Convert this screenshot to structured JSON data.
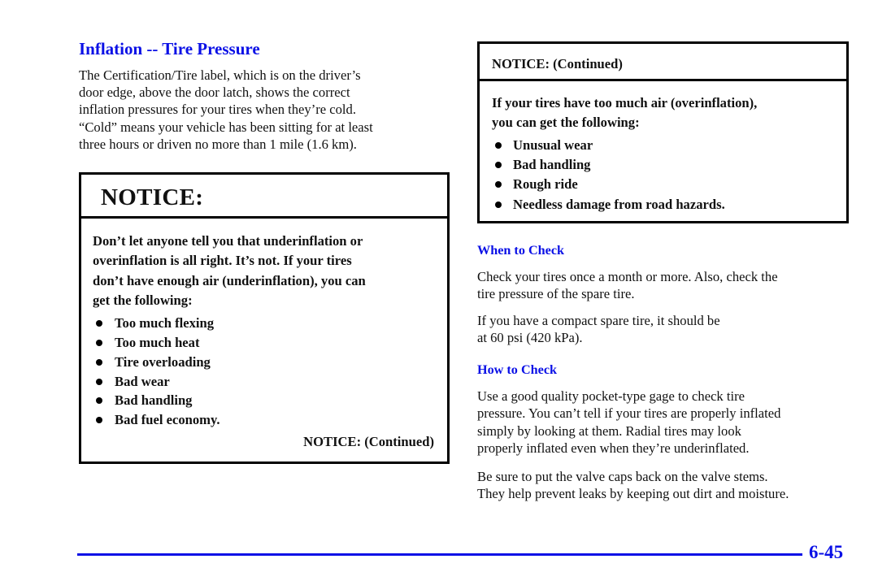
{
  "colors": {
    "accent": "#0a10e6",
    "text": "#111111",
    "border": "#000000"
  },
  "left_column": {
    "title": "Inflation -- Tire Pressure",
    "intro_lines": [
      "The Certification/Tire label, which is on the driver’s",
      "door edge, above the door latch, shows the correct",
      "inflation pressures for your tires when they’re cold.",
      "“Cold” means your vehicle has been sitting for at least",
      "three hours or driven no more than 1 mile (1.6 km)."
    ],
    "notice": {
      "header": "NOTICE:",
      "body_lines": [
        "Don’t let anyone tell you that underinflation or",
        "overinflation is all right. It’s not. If your tires",
        "don’t have enough air (underinflation), you can",
        "get the following:"
      ],
      "bullets": [
        "Too much flexing",
        "Too much heat",
        "Tire overloading",
        "Bad wear",
        "Bad handling",
        "Bad fuel economy."
      ],
      "continued": "NOTICE: (Continued)"
    }
  },
  "right_column": {
    "notice": {
      "header": "NOTICE: (Continued)",
      "body_lines": [
        "If your tires have too much air (overinflation),",
        "you can get the following:"
      ],
      "bullets": [
        "Unusual wear",
        "Bad handling",
        "Rough ride",
        "Needless damage from road hazards."
      ]
    },
    "when_to_check": {
      "title": "When to Check",
      "paragraphs": [
        [
          "Check your tires once a month or more. Also, check the",
          "tire pressure of the spare tire."
        ],
        [
          "If you have a compact spare tire, it should be",
          "at 60 psi (420 kPa)."
        ]
      ]
    },
    "how_to_check": {
      "title": "How to Check",
      "paragraphs": [
        [
          "Use a good quality pocket-type gage to check tire",
          "pressure. You can’t tell if your tires are properly inflated",
          "simply by looking at them. Radial tires may look",
          "properly inflated even when they’re underinflated."
        ],
        [
          "Be sure to put the valve caps back on the valve stems.",
          "They help prevent leaks by keeping out dirt and moisture."
        ]
      ]
    }
  },
  "footer": {
    "page_number": "6-45"
  }
}
